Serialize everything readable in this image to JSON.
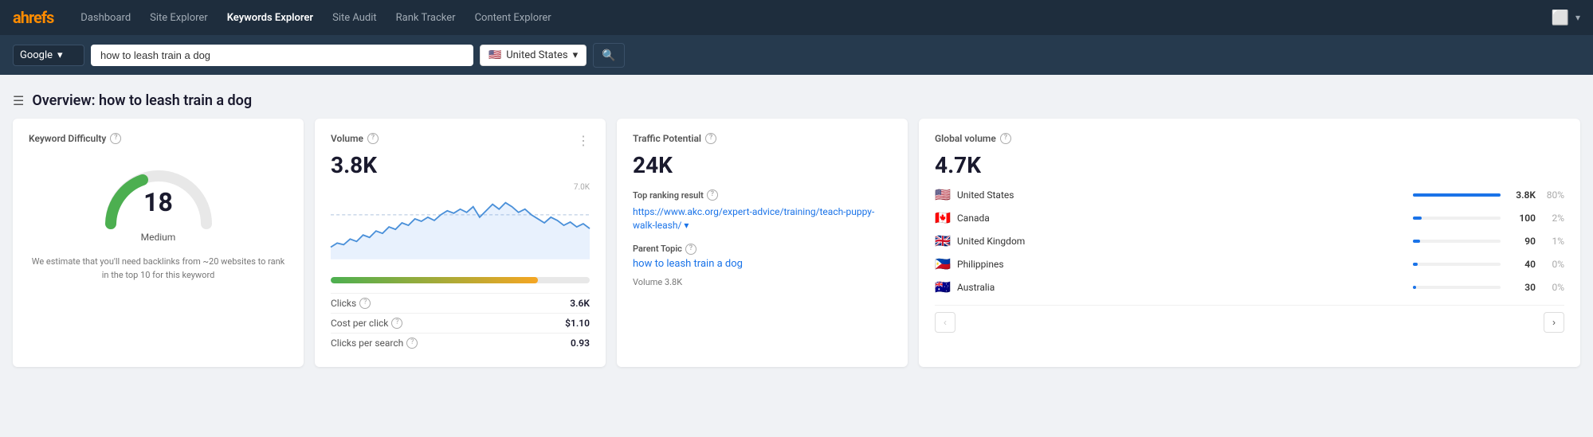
{
  "brand": "ahrefs",
  "nav": {
    "links": [
      {
        "label": "Dashboard",
        "active": false
      },
      {
        "label": "Site Explorer",
        "active": false
      },
      {
        "label": "Keywords Explorer",
        "active": true
      },
      {
        "label": "Site Audit",
        "active": false
      },
      {
        "label": "Rank Tracker",
        "active": false
      },
      {
        "label": "Content Explorer",
        "active": false
      }
    ]
  },
  "searchbar": {
    "engine": "Google",
    "engine_chevron": "▾",
    "query": "how to leash train a dog",
    "country": "United States",
    "country_chevron": "▾",
    "search_icon": "🔍"
  },
  "overview": {
    "title": "Overview: how to leash train a dog",
    "hamburger": "☰"
  },
  "kd_card": {
    "label": "Keyword Difficulty",
    "value": 18,
    "level": "Medium",
    "description": "We estimate that you'll need backlinks from ~20 websites\nto rank in the top 10 for this keyword",
    "info": "?"
  },
  "volume_card": {
    "label": "Volume",
    "value": "3.8K",
    "y_max": "7.0K",
    "info": "?",
    "bar_fill_pct": 80,
    "metrics": [
      {
        "label": "Clicks",
        "value": "3.6K"
      },
      {
        "label": "Cost per click",
        "value": "$1.10"
      },
      {
        "label": "Clicks per search",
        "value": "0.93"
      }
    ]
  },
  "traffic_card": {
    "label": "Traffic Potential",
    "value": "24K",
    "info": "?",
    "top_ranking_label": "Top ranking result",
    "top_ranking_url": "https://www.akc.org/expert-advice/training/teach-puppy-walk-leash/",
    "parent_topic_label": "Parent Topic",
    "parent_topic_link": "how to leash train a dog",
    "parent_volume": "Volume 3.8K"
  },
  "global_card": {
    "label": "Global volume",
    "value": "4.7K",
    "info": "?",
    "countries": [
      {
        "flag": "🇺🇸",
        "name": "United States",
        "num": "3.8K",
        "pct": "80%",
        "bar": 100
      },
      {
        "flag": "🇨🇦",
        "name": "Canada",
        "num": "100",
        "pct": "2%",
        "bar": 10
      },
      {
        "flag": "🇬🇧",
        "name": "United Kingdom",
        "num": "90",
        "pct": "1%",
        "bar": 8
      },
      {
        "flag": "🇵🇭",
        "name": "Philippines",
        "num": "40",
        "pct": "0%",
        "bar": 5
      },
      {
        "flag": "🇦🇺",
        "name": "Australia",
        "num": "30",
        "pct": "0%",
        "bar": 4
      }
    ],
    "prev_label": "‹",
    "next_label": "›"
  }
}
